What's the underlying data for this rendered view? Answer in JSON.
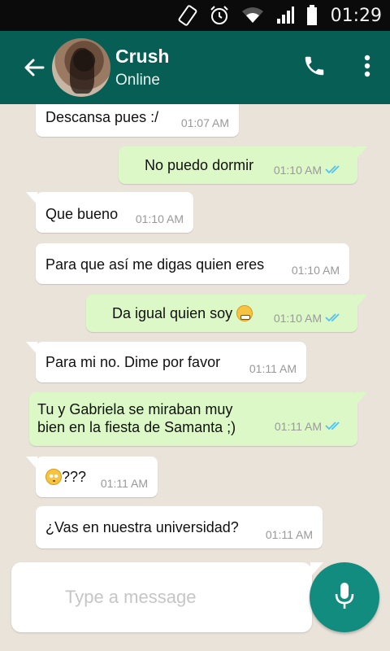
{
  "status_bar": {
    "time": "01:29",
    "icons": [
      "rotate-icon",
      "alarm-icon",
      "wifi-icon",
      "signal-icon",
      "battery-icon"
    ]
  },
  "header": {
    "contact_name": "Crush",
    "contact_status": "Online",
    "icons": [
      "back-arrow-icon",
      "phone-icon",
      "more-vert-icon"
    ],
    "background_color": "#075e54"
  },
  "messages": [
    {
      "direction": "incoming",
      "text": "Descansa pues :/",
      "time": "01:07 AM"
    },
    {
      "direction": "outgoing",
      "text": "No puedo dormir",
      "time": "01:10 AM",
      "ticks": "read"
    },
    {
      "direction": "incoming",
      "text": "Que bueno",
      "time": "01:10 AM"
    },
    {
      "direction": "incoming",
      "text": "Para que así me digas quien eres",
      "time": "01:10 AM"
    },
    {
      "direction": "outgoing",
      "text": "Da igual quien soy",
      "emoji": "grimacing-face",
      "time": "01:10 AM",
      "ticks": "read"
    },
    {
      "direction": "incoming",
      "text": "Para mi no. Dime por favor",
      "time": "01:11 AM"
    },
    {
      "direction": "outgoing",
      "lines": [
        "Tu y Gabriela se miraban muy",
        "bien en la fiesta de Samanta ;)"
      ],
      "time": "01:11 AM",
      "ticks": "read"
    },
    {
      "direction": "incoming",
      "emoji": "flushed-face",
      "text": "???",
      "time": "01:11 AM"
    },
    {
      "direction": "incoming",
      "text": "¿Vas en nuestra universidad?",
      "time": "01:11 AM"
    }
  ],
  "composer": {
    "placeholder": "Type a message",
    "value": "",
    "send_icon": "mic-icon"
  },
  "colors": {
    "incoming_bubble": "#ffffff",
    "outgoing_bubble": "#dcf8c6",
    "read_ticks": "#4fc3f7",
    "mic_button": "#128c7e"
  }
}
